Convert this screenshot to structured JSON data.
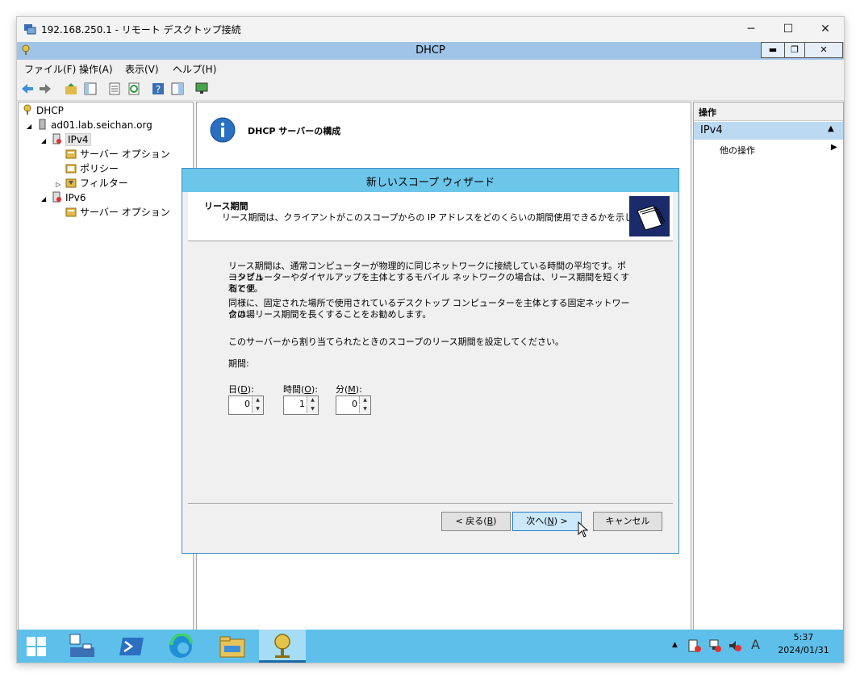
{
  "rdp": {
    "title": "192.168.250.1 - リモート デスクトップ接続",
    "minimize": "─",
    "maximize": "☐",
    "close": "✕"
  },
  "mmc": {
    "title": "DHCP",
    "btn_min": "▬",
    "btn_restore": "❐",
    "btn_close": "✕"
  },
  "menu": {
    "file": "ファイル(F)",
    "action": "操作(A)",
    "view": "表示(V)",
    "help": "ヘルプ(H)"
  },
  "tree": {
    "root": "DHCP",
    "server": "ad01.lab.seichan.org",
    "ipv4": "IPv4",
    "server_options": "サーバー オプション",
    "policies": "ポリシー",
    "filters": "フィルター",
    "ipv6": "IPv6",
    "server_options_v6": "サーバー オプション"
  },
  "center": {
    "info_title": "DHCP サーバーの構成"
  },
  "actions": {
    "header": "操作",
    "section": "IPv4",
    "more": "他の操作"
  },
  "wizard": {
    "title": "新しいスコープ ウィザード",
    "heading": "リース期間",
    "subheading": "リース期間は、クライアントがこのスコープからの IP アドレスをどのくらいの期間使用できるかを示します。",
    "para1_l1": "リース期間は、通常コンピューターが物理的に同じネットワークに接続している時間の平均です。ポータブル",
    "para1_l2": "コンピューターやダイヤルアップを主体とするモバイル ネットワークの場合は、リース期間を短くすると便",
    "para1_l3": "利です。",
    "para2_l1": "同様に、固定された場所で使用されているデスクトップ コンピューターを主体とする固定ネットワークの場",
    "para2_l2": "合は、リース期間を長くすることをお勧めします。",
    "instruction": "このサーバーから割り当てられたときのスコープのリース期間を設定してください。",
    "period_label": "期間:",
    "days_label_pre": "日(",
    "days_key": "D",
    "days_label_post": "):",
    "hours_label_pre": "時間(",
    "hours_key": "O",
    "hours_label_post": "):",
    "minutes_label_pre": "分(",
    "minutes_key": "M",
    "minutes_label_post": "):",
    "days_value": "0",
    "hours_value": "1",
    "minutes_value": "0",
    "back_pre": "< 戻る(",
    "back_key": "B",
    "back_post": ")",
    "next_pre": "次へ(",
    "next_key": "N",
    "next_post": ") >",
    "cancel": "キャンセル"
  },
  "taskbar": {
    "time": "5:37",
    "date": "2024/01/31",
    "ime": "A"
  },
  "colors": {
    "taskbar": "#5ec0ea",
    "wizard_title": "#6cc6ea",
    "mmc_title": "#9fc4e7"
  }
}
